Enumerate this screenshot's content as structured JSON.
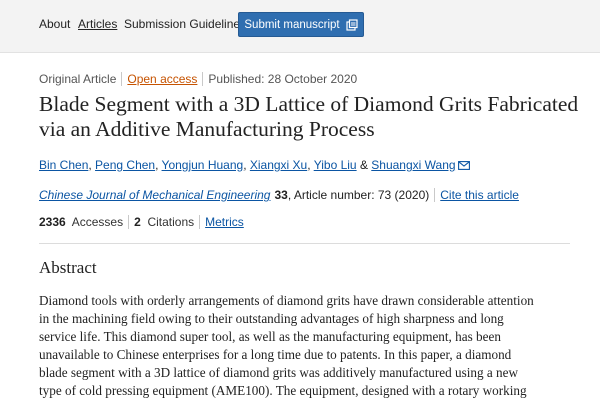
{
  "nav": {
    "about": "About",
    "articles": "Articles",
    "guidelines": "Submission Guidelines",
    "submit_label": "Submit manuscript"
  },
  "article": {
    "type": "Original Article",
    "access": "Open access",
    "published": "Published: 28 October 2020",
    "title": "Blade Segment with a 3D Lattice of Diamond Grits Fabricated via an Additive Manufacturing Process",
    "authors": [
      "Bin Chen",
      "Peng Chen",
      "Yongjun Huang",
      "Xiangxi Xu",
      "Yibo Liu",
      "Shuangxi Wang"
    ],
    "author_sep": ", ",
    "author_and": " & ",
    "journal": "Chinese Journal of Mechanical Engineering",
    "volume": "33",
    "article_number": ", Article number: 73 (2020)",
    "cite_label": "Cite this article",
    "accesses_count": "2336",
    "accesses_label": "Accesses",
    "citations_count": "2",
    "citations_label": "Citations",
    "metrics_label": "Metrics"
  },
  "abstract": {
    "heading": "Abstract",
    "lines": [
      "Diamond tools with orderly arrangements of diamond grits have drawn considerable attention",
      "in the machining field owing to their outstanding advantages of high sharpness and long",
      "service life. This diamond super tool, as well as the manufacturing equipment, has been",
      "unavailable to Chinese enterprises for a long time due to patents. In this paper, a diamond",
      "blade segment with a 3D lattice of diamond grits was additively manufactured using a new",
      "type of cold pressing equipment (AME100). The equipment, designed with a rotary working"
    ]
  },
  "colors": {
    "link": "#0b55a3",
    "open_access": "#c65301",
    "button": "#2f6eb0",
    "topbar": "#f3f3f3"
  },
  "icons": {
    "submit": "external-link-icon",
    "mail": "mail-icon"
  }
}
